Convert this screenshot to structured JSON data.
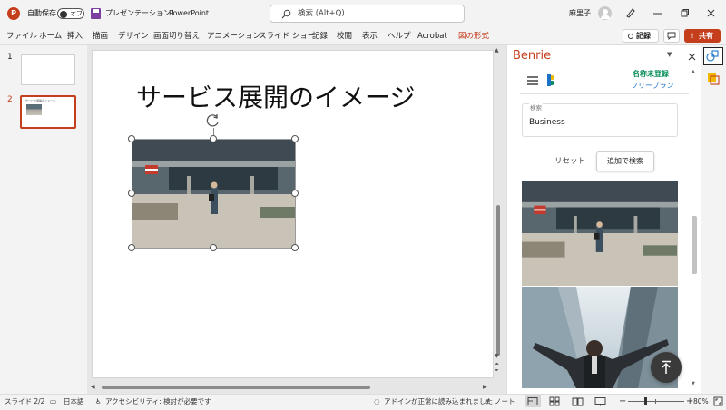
{
  "titlebar": {
    "autosave_label": "自動保存",
    "autosave_state": "オフ",
    "document_title": "プレゼンテーション1",
    "separator": "-",
    "app_name": "PowerPoint",
    "search_placeholder": "検索 (Alt+Q)",
    "user_name": "麻里子"
  },
  "ribbon": {
    "tabs": [
      "ファイル",
      "ホーム",
      "挿入",
      "描画",
      "デザイン",
      "画面切り替え",
      "アニメーション",
      "スライド ショー",
      "記録",
      "校閲",
      "表示",
      "ヘルプ",
      "Acrobat",
      "図の形式"
    ],
    "record_label": "記録",
    "share_label": "共有"
  },
  "thumbnails": [
    {
      "number": "1"
    },
    {
      "number": "2",
      "caption": "サービス展開のイメージ"
    }
  ],
  "slide": {
    "title": "サービス展開のイメージ"
  },
  "addin": {
    "title": "Benrie",
    "account_name": "名称未登録",
    "plan": "フリープラン",
    "search_label": "検索",
    "search_value": "Business",
    "reset_label": "リセット",
    "add_search_label": "追加で検索"
  },
  "status": {
    "slide_indicator": "スライド 2/2",
    "language": "日本語",
    "accessibility": "アクセシビリティ: 検討が必要です",
    "addin_notice": "アドインが正常に読み込まれました",
    "notes_label": "ノート",
    "zoom": "80%"
  },
  "colors": {
    "accent": "#c43e1c",
    "addin_title": "#c43e1c",
    "plan_green": "#0a8f5b",
    "plan_blue": "#1a73c9"
  }
}
